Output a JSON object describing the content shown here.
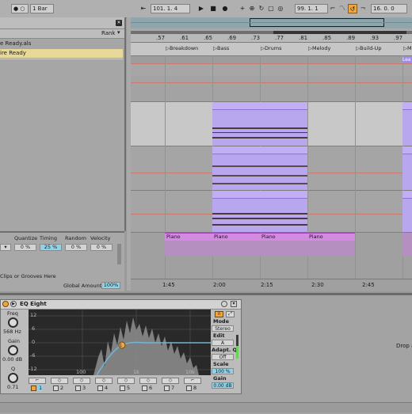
{
  "transport": {
    "metro_menu": "● ○",
    "quantize": "1 Bar",
    "position": "101.  1.  4",
    "loop_start": "99.  1.  1",
    "loop_length": "16.  0.  0",
    "play_icon": "play-icon",
    "stop_icon": "stop-icon",
    "record_icon": "record-icon",
    "accent": "#f3a63a"
  },
  "browser": {
    "column_rank": "Rank",
    "items": [
      {
        "name": "e Ready.als",
        "selected": false
      },
      {
        "name": "ire Ready",
        "selected": true
      }
    ]
  },
  "groove": {
    "headers": [
      "Quantize",
      "Timing",
      "Random",
      "Velocity"
    ],
    "values": [
      "0 %",
      "25 %",
      "0 %",
      "0 %"
    ],
    "hint": "Clips or Grooves Here",
    "global_label": "Global Amount",
    "global_value": "100%"
  },
  "arrangement": {
    "ruler_ticks": [
      ".57",
      ".61",
      ".65",
      ".69",
      ".73",
      ".77",
      ".81",
      ".85",
      ".89",
      ".93",
      ".97"
    ],
    "locators": [
      "Breakdown",
      "Bass",
      "Drums",
      "Melody",
      "Build-Up",
      "M"
    ],
    "lead_clip": "Lea",
    "piano_clips": [
      "Piano",
      "Piano",
      "Piano",
      "Piano"
    ],
    "times": [
      "1:45",
      "2:00",
      "2:15",
      "2:30",
      "2:45"
    ],
    "clip_color": "#b8a6ee",
    "piano_color": "#d38ae0"
  },
  "eq": {
    "title": "EQ Eight",
    "freq_label": "Freq",
    "freq_value": "568 Hz",
    "gain_label": "Gain",
    "gain_value": "0.00 dB",
    "q_label": "Q",
    "q_value": "0.71",
    "db_ticks": [
      "12",
      "6",
      "0",
      "-6",
      "-12"
    ],
    "freq_ticks": [
      "100",
      "1k",
      "10k"
    ],
    "mode_label": "Mode",
    "mode_value": "Stereo",
    "edit_label": "Edit",
    "edit_value": "A",
    "adapt_label": "Adapt. Q",
    "adapt_value": "Off",
    "scale_label": "Scale",
    "scale_value": "100 %",
    "gain2_label": "Gain",
    "gain2_value": "0.00 dB",
    "band_numbers": [
      "1",
      "2",
      "3",
      "4",
      "5",
      "6",
      "7",
      "8"
    ],
    "band_active": 1,
    "curve_color": "#6fb6d6"
  },
  "drop_hint": "Drop a"
}
